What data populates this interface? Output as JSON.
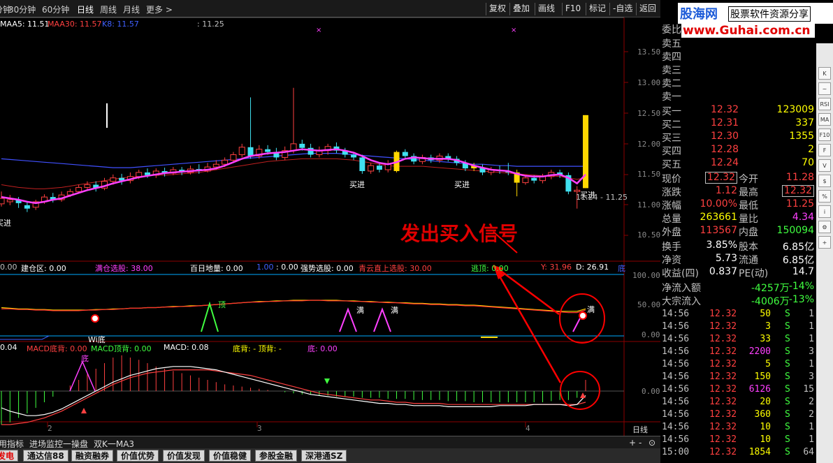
{
  "toolbar": {
    "periods": [
      "分钟",
      "30分钟",
      "60分钟",
      "日线",
      "周线",
      "月线",
      "更多 >"
    ],
    "right": [
      "复权",
      "叠加",
      "画线",
      "F10",
      "标记",
      "-自选",
      "返回"
    ]
  },
  "price_legend": [
    {
      "text": "MAA5: 11.51",
      "color": "#ffffff"
    },
    {
      "text": "MAA30: 11.57",
      "color": "#ff4040"
    },
    {
      "text": "K8: 11.57",
      "color": "#4060ff"
    },
    {
      "text": ": 11.25",
      "color": "#c0c0c0"
    }
  ],
  "buy_labels": [
    "买进",
    "买进",
    "买进",
    "买进"
  ],
  "price_readout": "11.24 - 11.25",
  "annotation": {
    "text": "发出买入信号",
    "color": "#e00000"
  },
  "ind_legend": [
    {
      "text": "0.00",
      "color": "#c0c0c0"
    },
    {
      "text": "建仓区: 0.00",
      "color": "#ffffff"
    },
    {
      "text": "满仓选股: 38.00",
      "color": "#ff40ff"
    },
    {
      "text": "百日地量: 0.00",
      "color": "#ffffff"
    },
    {
      "text": "1.00",
      "color": "#4060ff"
    },
    {
      "text": ": 0.00",
      "color": "#ffffff"
    },
    {
      "text": "强势选股: 0.00",
      "color": "#ffffff"
    },
    {
      "text": "青云直上选股: 30.00",
      "color": "#ff4040"
    },
    {
      "text": "逃顶: 0.00",
      "color": "#40ff40"
    },
    {
      "text": "Y: 31.96",
      "color": "#ff4040"
    },
    {
      "text": "D: 26.91",
      "color": "#ffffff"
    },
    {
      "text": "底",
      "color": "#4060ff"
    }
  ],
  "ind_markers": [
    "顶",
    "满",
    "满",
    "Wi底",
    "满"
  ],
  "macd_legend": [
    {
      "text": "0.04",
      "color": "#ffffff"
    },
    {
      "text": "MACD底背: 0.00",
      "color": "#ff4040"
    },
    {
      "text": "MACD顶背: 0.00",
      "color": "#40ff40"
    },
    {
      "text": "MACD: 0.08",
      "color": "#ffffff"
    },
    {
      "text": "底背: - 顶背: -",
      "color": "#ffff00"
    },
    {
      "text": "底: 0.00",
      "color": "#ff40ff"
    }
  ],
  "macd_marker": "底",
  "date_labels": [
    "2",
    "3",
    "4"
  ],
  "period_label": "日线",
  "right_axis": {
    "price": [
      "13.50",
      "13.00",
      "12.50",
      "12.00",
      "11.50",
      "11.00",
      "10.50"
    ],
    "ind": [
      "100.00",
      "50.00",
      "0.00"
    ],
    "macd": [
      "0.00"
    ]
  },
  "banner": {
    "site": "股海网",
    "slogan": "股票软件资源分享",
    "url": "www.Guhai.com.cn"
  },
  "order_book": {
    "header": "委比",
    "sell": [
      "卖五",
      "卖四",
      "卖三",
      "卖二",
      "卖一"
    ],
    "buy": [
      {
        "label": "买一",
        "price": "12.32",
        "vol": "123009"
      },
      {
        "label": "买二",
        "price": "12.31",
        "vol": "337"
      },
      {
        "label": "买三",
        "price": "12.30",
        "vol": "1355"
      },
      {
        "label": "买四",
        "price": "12.28",
        "vol": "2"
      },
      {
        "label": "买五",
        "price": "12.24",
        "vol": "70"
      }
    ]
  },
  "quote": [
    {
      "l1": "现价",
      "v1": "12.32",
      "c1": "#ff4040",
      "l2": "今开",
      "v2": "11.28",
      "c2": "#ff4040"
    },
    {
      "l1": "涨跌",
      "v1": "1.12",
      "c1": "#ff4040",
      "l2": "最高",
      "v2": "12.32",
      "c2": "#ff4040"
    },
    {
      "l1": "涨幅",
      "v1": "10.00%",
      "c1": "#ff4040",
      "l2": "最低",
      "v2": "11.25",
      "c2": "#ff4040"
    },
    {
      "l1": "总量",
      "v1": "263661",
      "c1": "#ffff00",
      "l2": "量比",
      "v2": "4.34",
      "c2": "#ff40ff"
    },
    {
      "l1": "外盘",
      "v1": "113567",
      "c1": "#ff4040",
      "l2": "内盘",
      "v2": "150094",
      "c2": "#40ff40"
    }
  ],
  "fundamentals": [
    {
      "l1": "换手",
      "v1": "3.85%",
      "l2": "股本",
      "v2": "6.85亿"
    },
    {
      "l1": "净资",
      "v1": "5.73",
      "l2": "流通",
      "v2": "6.85亿"
    },
    {
      "l1": "收益(四)",
      "v1": "0.837",
      "l2": "PE(动)",
      "v2": "14.7"
    }
  ],
  "flows": [
    {
      "label": "净流入额",
      "amount": "-4257万",
      "pct": "-14%"
    },
    {
      "label": "大宗流入",
      "amount": "-4006万",
      "pct": "-13%"
    }
  ],
  "ticks": [
    {
      "time": "14:56",
      "price": "12.32",
      "vol": "50",
      "side": "S",
      "n": "1"
    },
    {
      "time": "14:56",
      "price": "12.32",
      "vol": "3",
      "side": "S",
      "n": "1"
    },
    {
      "time": "14:56",
      "price": "12.32",
      "vol": "33",
      "side": "S",
      "n": "1"
    },
    {
      "time": "14:56",
      "price": "12.32",
      "vol": "2200",
      "side": "S",
      "n": "3"
    },
    {
      "time": "14:56",
      "price": "12.32",
      "vol": "5",
      "side": "S",
      "n": "1"
    },
    {
      "time": "14:56",
      "price": "12.32",
      "vol": "150",
      "side": "S",
      "n": "3"
    },
    {
      "time": "14:56",
      "price": "12.32",
      "vol": "6126",
      "side": "S",
      "n": "15"
    },
    {
      "time": "14:56",
      "price": "12.32",
      "vol": "20",
      "side": "S",
      "n": "2"
    },
    {
      "time": "14:56",
      "price": "12.32",
      "vol": "360",
      "side": "S",
      "n": "2"
    },
    {
      "time": "14:56",
      "price": "12.32",
      "vol": "10",
      "side": "S",
      "n": "1"
    },
    {
      "time": "14:56",
      "price": "12.32",
      "vol": "10",
      "side": "S",
      "n": "1"
    },
    {
      "time": "15:00",
      "price": "12.32",
      "vol": "1854",
      "side": "S",
      "n": "64"
    }
  ],
  "bottom_tabs1": [
    "用指标",
    "进场监控一操盘",
    "双K一MA3"
  ],
  "bottom_tabs2": [
    "发电",
    "通达信88",
    "融资融券",
    "价值优势",
    "价值发现",
    "价值稳健",
    "参股金融",
    "深港通SZ"
  ],
  "sidebar_icons": [
    "K",
    "~",
    "RSI",
    "MA",
    "F10",
    "F",
    "V",
    "$",
    "%",
    "i",
    "⚙",
    "+"
  ],
  "chart_data": {
    "type": "candlestick",
    "yrange": [
      10.2,
      13.7
    ],
    "candles": [
      [
        11.02,
        11.1,
        11.2,
        10.98
      ],
      [
        11.05,
        11.08,
        11.15,
        11.0
      ],
      [
        11.08,
        11.03,
        11.12,
        10.96
      ],
      [
        11.0,
        10.95,
        11.05,
        10.9
      ],
      [
        10.97,
        11.05,
        11.08,
        10.93
      ],
      [
        11.05,
        11.12,
        11.16,
        11.02
      ],
      [
        11.12,
        11.08,
        11.18,
        11.04
      ],
      [
        11.08,
        11.15,
        11.2,
        11.05
      ],
      [
        11.15,
        11.2,
        11.24,
        11.12
      ],
      [
        11.2,
        11.26,
        11.3,
        11.18
      ],
      [
        11.26,
        11.3,
        11.35,
        11.22
      ],
      [
        11.3,
        11.25,
        11.35,
        11.2
      ],
      [
        11.25,
        11.35,
        11.4,
        11.22
      ],
      [
        11.35,
        11.4,
        11.45,
        11.3
      ],
      [
        11.4,
        11.36,
        11.46,
        11.3
      ],
      [
        11.36,
        11.42,
        11.48,
        11.32
      ],
      [
        11.42,
        11.48,
        11.52,
        11.38
      ],
      [
        11.48,
        11.44,
        11.54,
        11.4
      ],
      [
        11.44,
        11.5,
        11.54,
        11.4
      ],
      [
        11.5,
        11.47,
        11.55,
        11.42
      ],
      [
        11.47,
        11.52,
        11.56,
        11.44
      ],
      [
        11.52,
        11.48,
        11.56,
        11.44
      ],
      [
        11.48,
        11.53,
        11.58,
        11.45
      ],
      [
        11.53,
        11.5,
        11.6,
        11.46
      ],
      [
        11.5,
        11.56,
        11.62,
        11.48
      ],
      [
        11.56,
        11.6,
        11.66,
        11.52
      ],
      [
        11.6,
        11.66,
        11.7,
        11.56
      ],
      [
        11.66,
        11.74,
        11.78,
        11.62
      ],
      [
        11.74,
        11.85,
        11.9,
        11.7
      ],
      [
        11.85,
        11.72,
        12.58,
        11.68
      ],
      [
        11.72,
        11.82,
        11.88,
        11.68
      ],
      [
        11.82,
        11.78,
        11.88,
        11.74
      ],
      [
        11.78,
        11.7,
        11.84,
        11.66
      ],
      [
        11.7,
        11.8,
        11.86,
        11.66
      ],
      [
        11.8,
        11.9,
        12.72,
        11.76
      ],
      [
        11.9,
        11.84,
        11.96,
        11.8
      ],
      [
        11.84,
        11.74,
        11.9,
        11.7
      ],
      [
        11.74,
        11.8,
        11.86,
        11.7
      ],
      [
        11.8,
        11.86,
        11.9,
        11.74
      ],
      [
        11.86,
        11.8,
        11.92,
        11.76
      ],
      [
        11.8,
        11.74,
        11.84,
        11.7
      ],
      [
        11.74,
        11.7,
        11.78,
        11.66
      ],
      [
        11.7,
        11.5,
        11.74,
        11.46
      ],
      [
        11.5,
        11.58,
        11.62,
        11.46
      ],
      [
        11.58,
        11.52,
        11.62,
        11.48
      ],
      [
        11.52,
        11.6,
        11.66,
        11.48
      ],
      [
        11.5,
        11.78,
        11.8,
        11.48
      ],
      [
        11.78,
        11.72,
        11.82,
        11.68
      ],
      [
        11.72,
        11.64,
        11.76,
        11.6
      ],
      [
        11.64,
        11.7,
        11.74,
        11.6
      ],
      [
        11.7,
        11.66,
        11.74,
        11.62
      ],
      [
        11.66,
        11.72,
        11.76,
        11.62
      ],
      [
        11.72,
        11.68,
        11.76,
        11.64
      ],
      [
        11.68,
        11.62,
        11.72,
        11.58
      ],
      [
        11.62,
        11.54,
        11.66,
        11.5
      ],
      [
        11.54,
        11.58,
        11.62,
        11.5
      ],
      [
        11.55,
        11.48,
        11.6,
        11.44
      ],
      [
        11.48,
        11.52,
        11.56,
        11.44
      ],
      [
        11.52,
        11.5,
        11.58,
        11.46
      ],
      [
        11.5,
        11.48,
        11.62,
        11.44
      ],
      [
        11.48,
        11.33,
        11.52,
        11.13
      ],
      [
        11.33,
        11.4,
        11.44,
        11.3
      ],
      [
        11.4,
        11.36,
        11.44,
        11.32
      ],
      [
        11.36,
        11.42,
        11.46,
        11.32
      ],
      [
        11.42,
        11.48,
        11.52,
        11.38
      ],
      [
        11.48,
        11.44,
        11.52,
        11.4
      ],
      [
        11.44,
        11.2,
        11.48,
        11.16
      ],
      [
        11.2,
        11.22,
        11.28,
        10.95
      ],
      [
        11.25,
        12.32,
        12.32,
        11.25
      ]
    ],
    "yellow_bars": [
      46,
      55,
      60,
      68
    ],
    "ma_pink": [
      11.12,
      11.1,
      11.08,
      11.05,
      11.03,
      11.05,
      11.08,
      11.1,
      11.14,
      11.18,
      11.22,
      11.25,
      11.28,
      11.32,
      11.35,
      11.38,
      11.41,
      11.43,
      11.45,
      11.47,
      11.48,
      11.49,
      11.5,
      11.51,
      11.52,
      11.54,
      11.58,
      11.63,
      11.68,
      11.72,
      11.74,
      11.76,
      11.77,
      11.78,
      11.8,
      11.82,
      11.81,
      11.8,
      11.81,
      11.82,
      11.8,
      11.77,
      11.72,
      11.66,
      11.62,
      11.6,
      11.63,
      11.68,
      11.7,
      11.69,
      11.68,
      11.68,
      11.68,
      11.66,
      11.62,
      11.58,
      11.55,
      11.52,
      11.51,
      11.5,
      11.46,
      11.43,
      11.42,
      11.42,
      11.44,
      11.45,
      11.4,
      11.32,
      11.45
    ],
    "ma_blue": [
      11.68,
      11.67,
      11.66,
      11.65,
      11.64,
      11.63,
      11.62,
      11.61,
      11.6,
      11.59,
      11.58,
      11.57,
      11.56,
      11.55,
      11.55,
      11.55,
      11.56,
      11.57,
      11.58,
      11.59,
      11.6,
      11.61,
      11.62,
      11.63,
      11.64,
      11.65,
      11.66,
      11.67,
      11.68,
      11.69,
      11.7,
      11.71,
      11.72,
      11.73,
      11.74,
      11.75,
      11.76,
      11.76,
      11.76,
      11.76,
      11.75,
      11.74,
      11.73,
      11.72,
      11.71,
      11.7,
      11.69,
      11.68,
      11.67,
      11.66,
      11.65,
      11.64,
      11.63,
      11.62,
      11.61,
      11.6,
      11.6,
      11.59,
      11.58,
      11.58,
      11.57,
      11.57,
      11.57,
      11.57,
      11.57,
      11.57,
      11.57,
      11.57,
      11.57
    ],
    "ma_red": [
      11.3,
      11.28,
      11.26,
      11.25,
      11.24,
      11.24,
      11.25,
      11.26,
      11.28,
      11.3,
      11.32,
      11.34,
      11.36,
      11.38,
      11.4,
      11.41,
      11.42,
      11.43,
      11.44,
      11.44,
      11.45,
      11.46,
      11.47,
      11.48,
      11.5,
      11.52,
      11.54,
      11.56,
      11.58,
      11.6,
      11.62,
      11.64,
      11.65,
      11.66,
      11.67,
      11.68,
      11.68,
      11.68,
      11.68,
      11.68,
      11.67,
      11.66,
      11.64,
      11.62,
      11.6,
      11.58,
      11.57,
      11.57,
      11.57,
      11.57,
      11.56,
      11.55,
      11.54,
      11.53,
      11.52,
      11.51,
      11.5,
      11.49,
      11.48,
      11.47,
      11.46,
      11.45,
      11.44,
      11.43,
      11.43,
      11.42,
      11.4,
      11.38,
      11.4
    ],
    "ind_yellow": [
      46,
      45,
      44,
      44,
      43,
      43,
      42,
      42,
      42,
      42,
      42,
      43,
      43,
      44,
      44,
      45,
      45,
      46,
      46,
      47,
      48,
      48,
      49,
      49,
      50,
      51,
      52,
      53,
      54,
      55,
      56,
      56,
      57,
      57,
      58,
      58,
      58,
      58,
      58,
      58,
      57,
      57,
      56,
      56,
      55,
      55,
      54,
      54,
      53,
      53,
      52,
      52,
      51,
      51,
      50,
      50,
      49,
      48,
      47,
      46,
      45,
      44,
      43,
      42,
      41,
      40,
      40,
      40,
      44
    ],
    "ind_red": [
      44,
      44,
      43,
      43,
      42,
      42,
      41,
      41,
      41,
      41,
      42,
      42,
      43,
      43,
      44,
      45,
      45,
      46,
      46,
      47,
      47,
      48,
      48,
      49,
      50,
      51,
      52,
      53,
      54,
      55,
      55,
      56,
      56,
      57,
      57,
      57,
      58,
      58,
      57,
      57,
      57,
      56,
      56,
      55,
      55,
      54,
      54,
      53,
      52,
      52,
      51,
      51,
      50,
      50,
      49,
      49,
      48,
      47,
      46,
      45,
      44,
      43,
      42,
      41,
      40,
      39,
      38,
      38,
      42
    ],
    "macd_hist": [
      -30,
      -28,
      -24,
      -20,
      -15,
      -10,
      -5,
      0,
      5,
      10,
      15,
      20,
      25,
      30,
      32,
      30,
      28,
      25,
      22,
      20,
      18,
      16,
      14,
      12,
      10,
      8,
      6,
      5,
      4,
      3,
      2,
      1,
      0,
      -1,
      -2,
      -3,
      -3,
      -4,
      -4,
      -5,
      -5,
      -5,
      -6,
      -6,
      -6,
      -7,
      -7,
      -7,
      -8,
      -8,
      -8,
      -8,
      -9,
      -9,
      -9,
      -10,
      -10,
      -10,
      -10,
      -10,
      -10,
      -10,
      -10,
      -10,
      -9,
      -8,
      -8,
      -6,
      10
    ],
    "macd_white": [
      -15,
      -18,
      -20,
      -22,
      -22,
      -21,
      -19,
      -16,
      -12,
      -8,
      -4,
      0,
      4,
      8,
      11,
      14,
      16,
      18,
      20,
      21,
      22,
      22,
      22,
      21,
      20,
      19,
      17,
      15,
      13,
      11,
      9,
      7,
      5,
      3,
      1,
      -1,
      -3,
      -4,
      -5,
      -6,
      -7,
      -8,
      -9,
      -10,
      -11,
      -11,
      -12,
      -12,
      -13,
      -13,
      -13,
      -13,
      -14,
      -14,
      -14,
      -14,
      -14,
      -14,
      -13,
      -13,
      -13,
      -13,
      -12,
      -12,
      -12,
      -12,
      -13,
      -12,
      -4
    ],
    "macd_red": [
      -30,
      -30,
      -29,
      -28,
      -26,
      -24,
      -21,
      -18,
      -14,
      -10,
      -6,
      -2,
      2,
      6,
      9,
      12,
      14,
      16,
      17,
      18,
      19,
      19,
      19,
      19,
      19,
      18,
      17,
      16,
      15,
      14,
      12,
      10,
      8,
      6,
      4,
      2,
      0,
      -2,
      -3,
      -4,
      -5,
      -6,
      -7,
      -8,
      -8,
      -9,
      -10,
      -10,
      -11,
      -11,
      -11,
      -11,
      -12,
      -12,
      -12,
      -12,
      -12,
      -12,
      -12,
      -12,
      -12,
      -12,
      -12,
      -12,
      -12,
      -12,
      -12,
      -12,
      -10
    ]
  }
}
